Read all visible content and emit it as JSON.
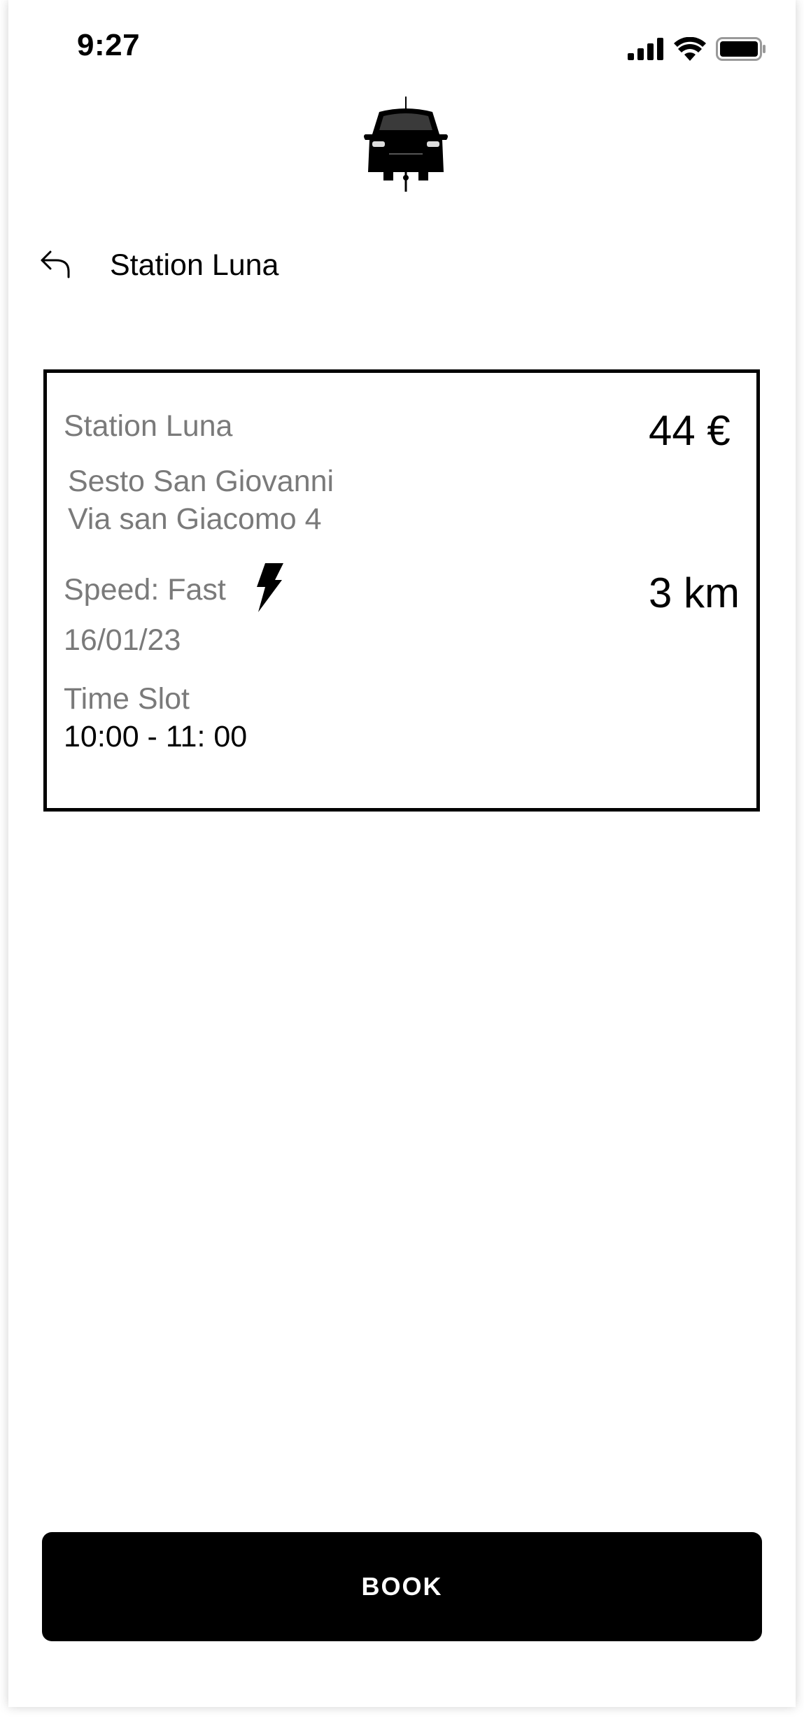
{
  "status_bar": {
    "time": "9:27",
    "icons": [
      "cellular-signal-icon",
      "wifi-icon",
      "battery-icon"
    ]
  },
  "header": {
    "logo_icon": "car-charging-icon",
    "back_icon": "back-arrow-icon",
    "title": "Station Luna"
  },
  "card": {
    "station_name": "Station Luna",
    "price": "44 €",
    "address_line1": "Sesto San Giovanni",
    "address_line2": "Via san Giacomo 4",
    "speed": "Speed: Fast",
    "speed_icon": "lightning-bolt-icon",
    "distance": "3 km",
    "date": "16/01/23",
    "time_slot_label": "Time Slot",
    "time_slot_value": "10:00 - 11: 00"
  },
  "actions": {
    "book_label": "BOOK"
  },
  "colors": {
    "primary": "#000000",
    "secondary_text": "#7a7a7a",
    "background": "#ffffff"
  }
}
